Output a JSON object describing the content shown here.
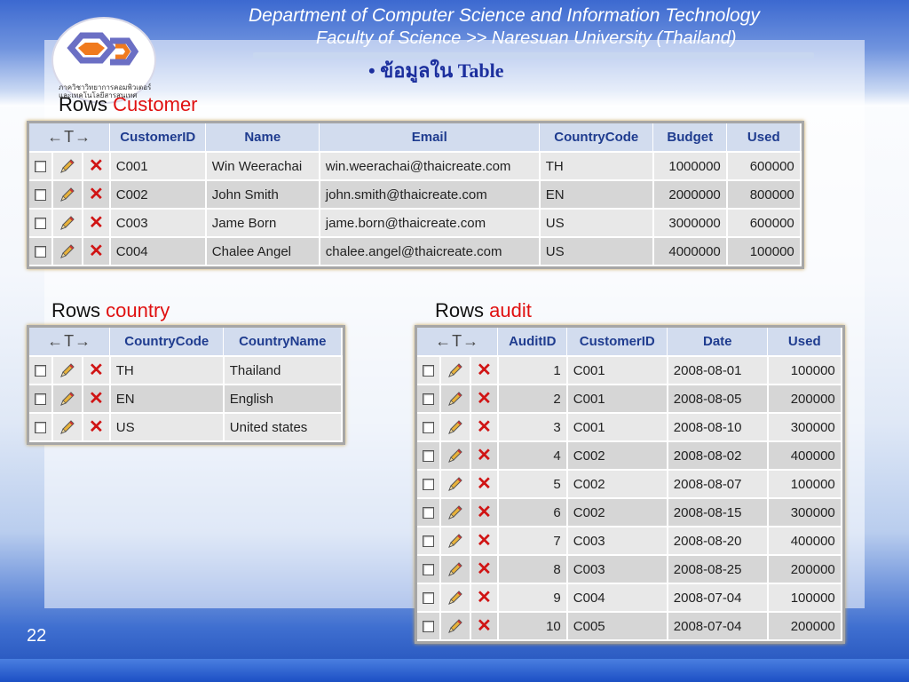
{
  "header": {
    "department": "Department of Computer Science and Information Technology",
    "faculty": "Faculty of Science",
    "university": ">> Naresuan University (Thailand)",
    "heading_thai": "• ข้อมูลใน",
    "heading_en": "Table",
    "logo_text": "ภาควิชาวิทยาการคอมพิวเตอร์และเทคโนโลยีสารสนเทศ"
  },
  "customer": {
    "label_prefix": "Rows",
    "label_name": "Customer",
    "arrows": "←T→",
    "columns": [
      "CustomerID",
      "Name",
      "Email",
      "CountryCode",
      "Budget",
      "Used"
    ],
    "rows": [
      [
        "C001",
        "Win Weerachai",
        "win.weerachai@thaicreate.com",
        "TH",
        "1000000",
        "600000"
      ],
      [
        "C002",
        "John  Smith",
        "john.smith@thaicreate.com",
        "EN",
        "2000000",
        "800000"
      ],
      [
        "C003",
        "Jame Born",
        "jame.born@thaicreate.com",
        "US",
        "3000000",
        "600000"
      ],
      [
        "C004",
        "Chalee Angel",
        "chalee.angel@thaicreate.com",
        "US",
        "4000000",
        "100000"
      ]
    ]
  },
  "country": {
    "label_prefix": "Rows",
    "label_name": "country",
    "arrows": "←T→",
    "columns": [
      "CountryCode",
      "CountryName"
    ],
    "rows": [
      [
        "TH",
        "Thailand"
      ],
      [
        "EN",
        "English"
      ],
      [
        "US",
        "United states"
      ]
    ]
  },
  "audit": {
    "label_prefix": "Rows",
    "label_name": "audit",
    "arrows": "←T→",
    "columns": [
      "AuditID",
      "CustomerID",
      "Date",
      "Used"
    ],
    "rows": [
      [
        "1",
        "C001",
        "2008-08-01",
        "100000"
      ],
      [
        "2",
        "C001",
        "2008-08-05",
        "200000"
      ],
      [
        "3",
        "C001",
        "2008-08-10",
        "300000"
      ],
      [
        "4",
        "C002",
        "2008-08-02",
        "400000"
      ],
      [
        "5",
        "C002",
        "2008-08-07",
        "100000"
      ],
      [
        "6",
        "C002",
        "2008-08-15",
        "300000"
      ],
      [
        "7",
        "C003",
        "2008-08-20",
        "400000"
      ],
      [
        "8",
        "C003",
        "2008-08-25",
        "200000"
      ],
      [
        "9",
        "C004",
        "2008-07-04",
        "100000"
      ],
      [
        "10",
        "C005",
        "2008-07-04",
        "200000"
      ]
    ]
  },
  "page_number": "22",
  "icons": {
    "row_checkbox": "checkbox-icon",
    "row_edit": "pencil-icon",
    "row_delete": "delete-x-icon"
  },
  "colors": {
    "header_bg": "#d2dcee",
    "header_text": "#1f3c8f",
    "label_accent": "#e01010",
    "heading": "#1c2f9e"
  }
}
